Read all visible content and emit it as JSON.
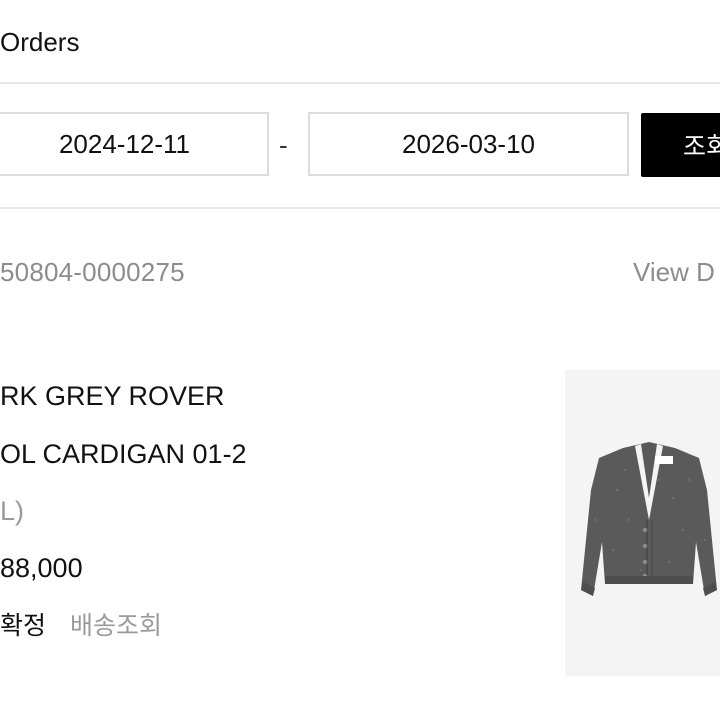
{
  "header": {
    "title": "Orders"
  },
  "filter": {
    "start_date": "2024-12-11",
    "separator": "-",
    "end_date": "2026-03-10",
    "search_label": "조회"
  },
  "order": {
    "number": "50804-0000275",
    "view_details_label": "View D",
    "product": {
      "name_line1": "RK GREY ROVER",
      "name_line2": "OL CARDIGAN 01-2",
      "option": "L)",
      "price": "88,000",
      "image_icon": "cardigan-image"
    },
    "status": "확정",
    "track_label": "배송조회"
  },
  "colors": {
    "accent": "#000000",
    "muted_text": "#8c8c8c",
    "border": "#dcdcdc",
    "image_bg": "#f4f4f4",
    "garment": "#5a5a5a"
  }
}
